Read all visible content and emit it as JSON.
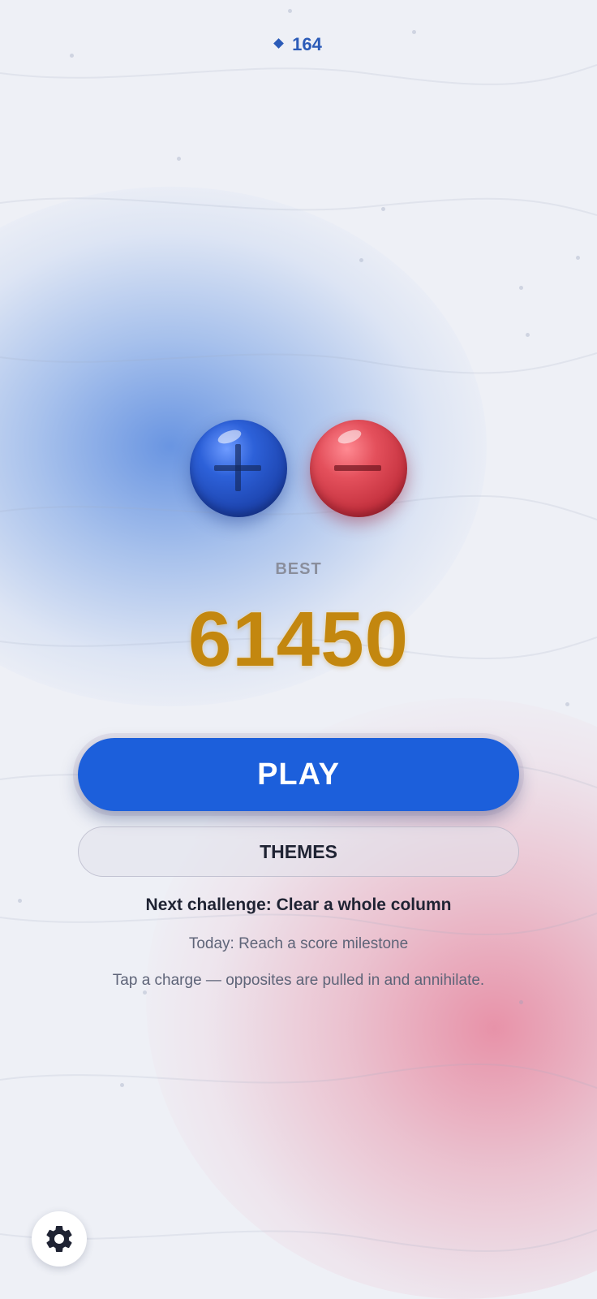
{
  "header": {
    "currency_icon": "diamond-icon",
    "currency_value": "164"
  },
  "charges": {
    "positive_icon": "plus-icon",
    "negative_icon": "minus-icon",
    "colors": {
      "positive": "#2d61d9",
      "negative": "#e4505c"
    }
  },
  "best": {
    "label": "BEST",
    "score": "61450"
  },
  "buttons": {
    "play_label": "PLAY",
    "themes_label": "THEMES",
    "settings_icon": "gear-icon"
  },
  "info": {
    "next_challenge": "Next challenge: Clear a whole column",
    "today": "Today: Reach a score milestone",
    "hint": "Tap a charge — opposites are pulled in and annihilate."
  },
  "colors": {
    "accent": "#1c5fdb",
    "score": "#c3870f",
    "text_dark": "#1f2333",
    "text_muted": "#5e6478"
  }
}
